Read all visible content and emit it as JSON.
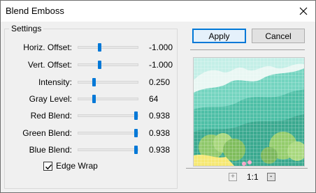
{
  "window": {
    "title": "Blend Emboss"
  },
  "settings": {
    "group_label": "Settings",
    "sliders": [
      {
        "label": "Horiz. Offset:",
        "value_text": "-1.000",
        "position": 0.35
      },
      {
        "label": "Vert. Offset:",
        "value_text": "-1.000",
        "position": 0.35
      },
      {
        "label": "Intensity:",
        "value_text": "0.250",
        "position": 0.26
      },
      {
        "label": "Gray Level:",
        "value_text": "64",
        "position": 0.26
      },
      {
        "label": "Red Blend:",
        "value_text": "0.938",
        "position": 0.97
      },
      {
        "label": "Green Blend:",
        "value_text": "0.938",
        "position": 0.97
      },
      {
        "label": "Blue Blend:",
        "value_text": "0.938",
        "position": 0.97
      }
    ],
    "edge_wrap": {
      "label": "Edge Wrap",
      "checked": true
    }
  },
  "buttons": {
    "apply": "Apply",
    "cancel": "Cancel"
  },
  "zoom": {
    "plus": "+",
    "level": "1:1",
    "minus": "-"
  },
  "colors": {
    "accent": "#0078d7",
    "sky": "#b9ece4",
    "hills": "#56c7b0"
  }
}
